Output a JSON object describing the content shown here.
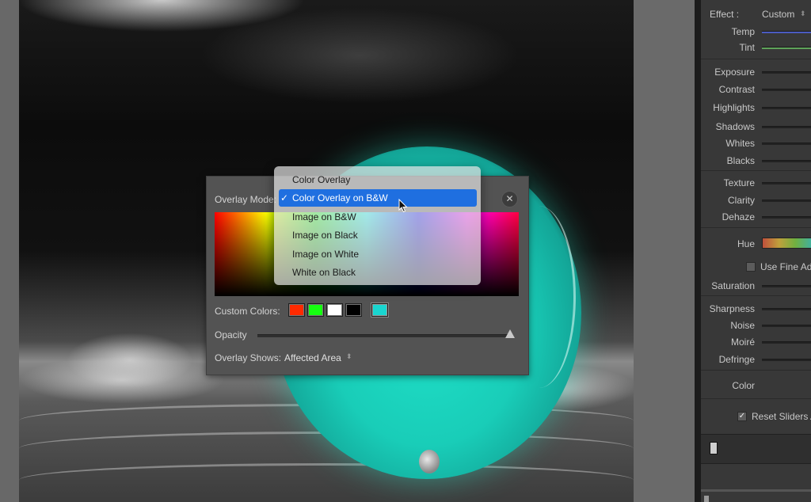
{
  "overlay_panel": {
    "mode_label": "Overlay Mode:",
    "close_icon": "close-icon",
    "custom_colors_label": "Custom Colors:",
    "custom_colors": [
      "#ff2a00",
      "#16ff10",
      "#ffffff",
      "#000000",
      "#19d6d0"
    ],
    "opacity_label": "Opacity",
    "opacity_value": 1.0,
    "overlay_shows_label": "Overlay Shows:",
    "overlay_shows_value": "Affected Area"
  },
  "dropdown": {
    "items": [
      {
        "label": "Color Overlay",
        "selected": false
      },
      {
        "label": "Color Overlay on B&W",
        "selected": true
      },
      {
        "label": "Image on B&W",
        "selected": false
      },
      {
        "label": "Image on Black",
        "selected": false
      },
      {
        "label": "Image on White",
        "selected": false
      },
      {
        "label": "White on Black",
        "selected": false
      }
    ]
  },
  "develop_panel": {
    "effect_label": "Effect :",
    "effect_value": "Custom",
    "sliders": [
      "Temp",
      "Tint",
      "Exposure",
      "Contrast",
      "Highlights",
      "Shadows",
      "Whites",
      "Blacks",
      "Texture",
      "Clarity",
      "Dehaze",
      "Hue",
      "Saturation",
      "Sharpness",
      "Noise",
      "Moiré",
      "Defringe",
      "Color"
    ],
    "use_fine_label": "Use Fine Adj",
    "reset_label": "Reset Sliders A"
  },
  "colors": {
    "accent": "#1f6fe0",
    "mask_overlay": "#19cdb8"
  }
}
